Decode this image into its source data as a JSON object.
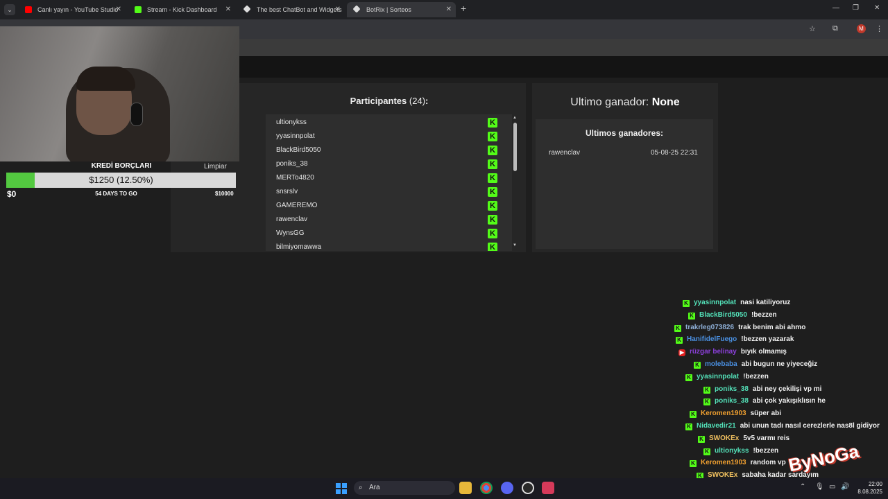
{
  "browser": {
    "tabs": [
      {
        "label": "Canlı yayın - YouTube Studio",
        "color": "#ff0000"
      },
      {
        "label": "Stream - Kick Dashboard",
        "color": "#53fc18"
      },
      {
        "label": "The best ChatBot and Widgets",
        "color": "#ffffff"
      },
      {
        "label": "BotRix | Sorteos",
        "color": "#ffffff"
      }
    ],
    "avatar_letter": "M"
  },
  "sorteo": {
    "participants_label": "Participantes",
    "participants_count": "(24)",
    "participants_suffix": ":",
    "participants": [
      "ultionykss",
      "yyasinnpolat",
      "BlackBird5050",
      "poniks_38",
      "MERTo4820",
      "snsrslv",
      "GAMEREMO",
      "rawenclav",
      "WynsGG",
      "bilmiyomawwa"
    ],
    "last_winner_label": "Ultimo ganador:",
    "last_winner_value": "None",
    "winners_title": "Ultimos ganadores:",
    "winners": [
      {
        "name": "rawenclav",
        "date": "05-08-25 22:31"
      }
    ],
    "partial_text": "ntes"
  },
  "overlay": {
    "goal_title": "KREDİ BORÇLARI",
    "limpiar": "Limpiar",
    "goal_text": "$1250 (12.50%)",
    "goal_fraction": 0.125,
    "goal_min": "$0",
    "goal_days": "54 DAYS TO GO",
    "goal_max": "$10000",
    "kick_green": "#53fc18"
  },
  "chat": [
    {
      "user": "yyasinnpolat",
      "color": "#53e0b8",
      "text": "nasi katiliyoruz",
      "platform": "kick"
    },
    {
      "user": "BlackBird5050",
      "color": "#53e0b8",
      "text": "!bezzen",
      "platform": "kick"
    },
    {
      "user": "trakrleg073826",
      "color": "#8fb0d8",
      "text": "trak benim abi ahmo",
      "platform": "kick"
    },
    {
      "user": "HanifidelFuego",
      "color": "#4a90e2",
      "text": "!bezzen yazarak",
      "platform": "kick"
    },
    {
      "user": "rüzgar belinay",
      "color": "#8a3fd8",
      "text": "bıyık olmamış",
      "platform": "youtube"
    },
    {
      "user": "molebaba",
      "color": "#4a90e2",
      "text": "abi bugun ne yiyeceğiz",
      "platform": "kick"
    },
    {
      "user": "yyasinnpolat",
      "color": "#53e0b8",
      "text": "!bezzen",
      "platform": "kick"
    },
    {
      "user": "poniks_38",
      "color": "#53e0b8",
      "text": "abi ney çekilişi vp mi",
      "platform": "kick"
    },
    {
      "user": "poniks_38",
      "color": "#53e0b8",
      "text": "abi çok yakışıklısın he",
      "platform": "kick"
    },
    {
      "user": "Keromen1903",
      "color": "#f0a030",
      "text": "süper abi",
      "platform": "kick"
    },
    {
      "user": "Nidavedir21",
      "color": "#53e0b8",
      "text": "abi unun tadı nasıl cerezlerle nas8l gidiyor",
      "platform": "kick"
    },
    {
      "user": "SWOKEx",
      "color": "#f0c060",
      "text": "5v5 varmı reis",
      "platform": "kick"
    },
    {
      "user": "ultionykss",
      "color": "#53e0b8",
      "text": "!bezzen",
      "platform": "kick"
    },
    {
      "user": "Keromen1903",
      "color": "#f0a030",
      "text": "random vp",
      "platform": "kick"
    },
    {
      "user": "SWOKEx",
      "color": "#f0c060",
      "text": "sabaha kadar sardayım",
      "platform": "kick"
    }
  ],
  "watermark": "ByNoGa",
  "taskbar": {
    "search_placeholder": "Ara",
    "time": "22:00",
    "date": "8.08.2025"
  }
}
